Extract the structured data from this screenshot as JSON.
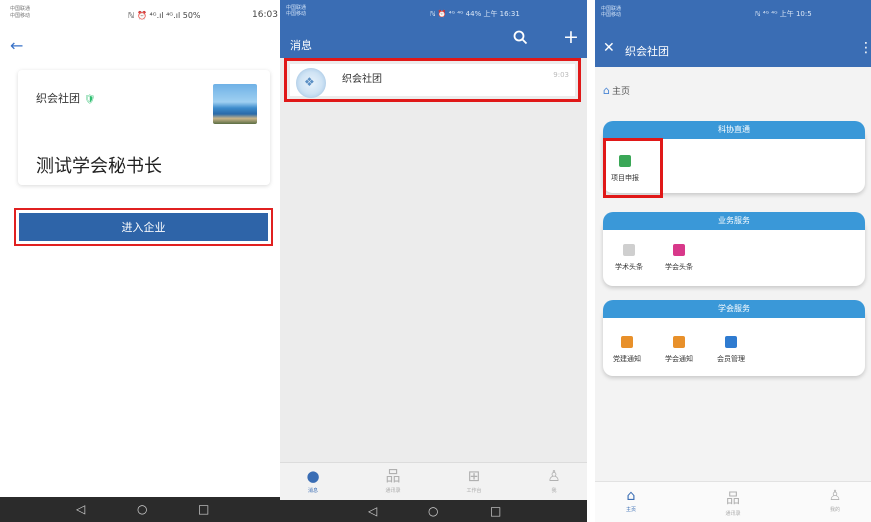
{
  "panel1": {
    "status": {
      "carrier": "中国联通\n中国移动",
      "icons": "ℕ ⏰ ⁴ᴳ.ıl ⁴ᴳ.ıl 50%",
      "time": "16:03"
    },
    "back_icon": "arrow-left-icon",
    "org_name": "织会社团",
    "verified_icon": "shield-check-icon",
    "role_title": "测试学会秘书长",
    "enter_button": "进入企业",
    "nav": [
      "◁",
      "○",
      "□"
    ]
  },
  "panel2": {
    "status": {
      "carrier": "中国联通\n中国移动",
      "icons": "ℕ ⏰ ⁴ᴳ ⁴ᴳ 44% 上午 16:31"
    },
    "title": "消息",
    "chat": {
      "name": "织会社团",
      "time": "9:03"
    },
    "tabs": [
      {
        "icon": "chat-bubble-icon",
        "label": "消息"
      },
      {
        "icon": "org-chart-icon",
        "label": "通讯录"
      },
      {
        "icon": "grid-icon",
        "label": "工作台"
      },
      {
        "icon": "person-icon",
        "label": "我"
      }
    ],
    "nav": [
      "◁",
      "○",
      "□"
    ]
  },
  "panel3": {
    "status": {
      "carrier": "中国联通\n中国移动",
      "icons": "ℕ ⁴ᴳ ⁴ᴳ 上午 10:5"
    },
    "title": "织会社团",
    "breadcrumb": "主页",
    "sections": [
      {
        "title": "科协直通",
        "items": [
          {
            "label": "项目申报",
            "color": "#3aa757"
          }
        ]
      },
      {
        "title": "业务服务",
        "items": [
          {
            "label": "学术头条",
            "color": "#cfcfcf"
          },
          {
            "label": "学会头条",
            "color": "#d8388a"
          }
        ]
      },
      {
        "title": "学会服务",
        "items": [
          {
            "label": "党建通知",
            "color": "#e8902a"
          },
          {
            "label": "学会通知",
            "color": "#e8902a"
          },
          {
            "label": "会员管理",
            "color": "#2f7bd0"
          }
        ]
      }
    ],
    "tabs": [
      {
        "icon": "home-icon",
        "label": "主页"
      },
      {
        "icon": "org-chart-icon",
        "label": "通讯录"
      },
      {
        "icon": "person-icon",
        "label": "我的"
      }
    ]
  }
}
